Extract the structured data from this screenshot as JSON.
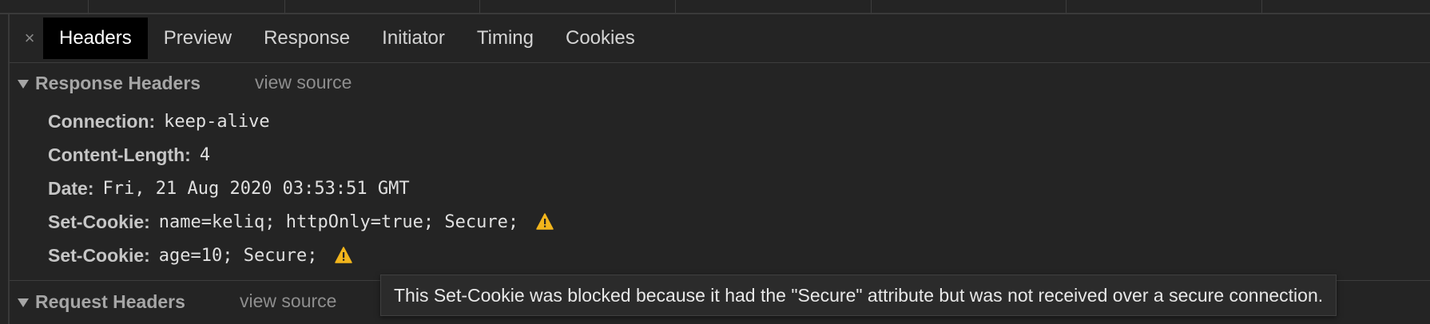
{
  "tabs": [
    {
      "label": "Headers",
      "active": true
    },
    {
      "label": "Preview",
      "active": false
    },
    {
      "label": "Response",
      "active": false
    },
    {
      "label": "Initiator",
      "active": false
    },
    {
      "label": "Timing",
      "active": false
    },
    {
      "label": "Cookies",
      "active": false
    }
  ],
  "close_glyph": "×",
  "response_headers": {
    "title": "Response Headers",
    "view_source": "view source",
    "rows": [
      {
        "name": "Connection:",
        "value": "keep-alive",
        "warning": false
      },
      {
        "name": "Content-Length:",
        "value": "4",
        "warning": false
      },
      {
        "name": "Date:",
        "value": "Fri, 21 Aug 2020 03:53:51 GMT",
        "warning": false
      },
      {
        "name": "Set-Cookie:",
        "value": "name=keliq; httpOnly=true; Secure;",
        "warning": true
      },
      {
        "name": "Set-Cookie:",
        "value": "age=10; Secure;",
        "warning": true
      }
    ]
  },
  "request_headers": {
    "title": "Request Headers",
    "view_source": "view source"
  },
  "tooltip": {
    "text": "This Set-Cookie was blocked because it had the \"Secure\" attribute but was not received over a secure connection."
  },
  "colors": {
    "warning": "#f2b51c",
    "background": "#242424",
    "active_tab": "#000000"
  },
  "icons": {
    "warning": "warning-icon",
    "close": "close-icon",
    "expand": "triangle-down-icon"
  }
}
